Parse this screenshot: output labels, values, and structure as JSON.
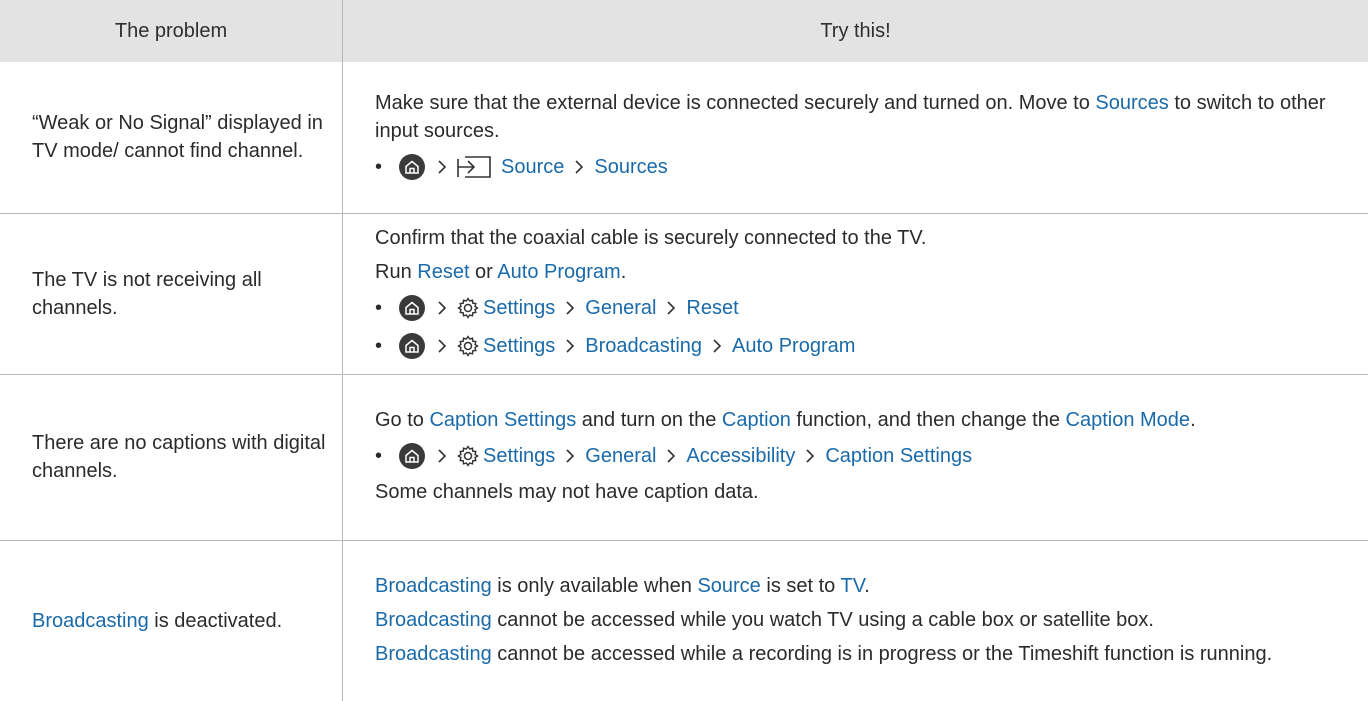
{
  "header": {
    "problem": "The problem",
    "try_this": "Try this!"
  },
  "rows": [
    {
      "problem": "“Weak or No Signal” displayed in TV mode/ cannot find channel.",
      "p1_a": "Make sure that the external device is connected securely and turned on. Move to ",
      "p1_link": "Sources",
      "p1_b": " to switch to other input sources.",
      "path": [
        "Source",
        "Sources"
      ]
    },
    {
      "problem": "The TV is not receiving all channels.",
      "p1": "Confirm that the coaxial cable is securely connected to the TV.",
      "p2_a": "Run ",
      "p2_link1": "Reset",
      "p2_b": " or ",
      "p2_link2": "Auto Program",
      "p2_c": ".",
      "path1": [
        "Settings",
        "General",
        "Reset"
      ],
      "path2": [
        "Settings",
        "Broadcasting",
        "Auto Program"
      ]
    },
    {
      "problem": "There are no captions with digital channels.",
      "p1_a": "Go to ",
      "p1_link1": "Caption Settings",
      "p1_b": " and turn on the ",
      "p1_link2": "Caption",
      "p1_c": " function, and then change the ",
      "p1_link3": "Caption Mode",
      "p1_d": ".",
      "path": [
        "Settings",
        "General",
        "Accessibility",
        "Caption Settings"
      ],
      "p2": "Some channels may not have caption data."
    },
    {
      "problem_link": "Broadcasting",
      "problem_rest": " is deactivated.",
      "p1_link1": "Broadcasting",
      "p1_a": " is only available when ",
      "p1_link2": "Source",
      "p1_b": " is set to ",
      "p1_link3": "TV",
      "p1_c": ".",
      "p2_link": "Broadcasting",
      "p2_a": " cannot be accessed while you watch TV using a cable box or satellite box.",
      "p3_link": "Broadcasting",
      "p3_a": " cannot be accessed while a recording is in progress or the Timeshift function is running."
    }
  ],
  "colors": {
    "link": "#1a6aaa",
    "header_bg": "#e3e3e3",
    "border": "#b7b7b7"
  },
  "icons": {
    "home": "home-icon",
    "settings": "gear-icon",
    "source": "source-input-icon",
    "separator": "chevron-right-icon"
  }
}
